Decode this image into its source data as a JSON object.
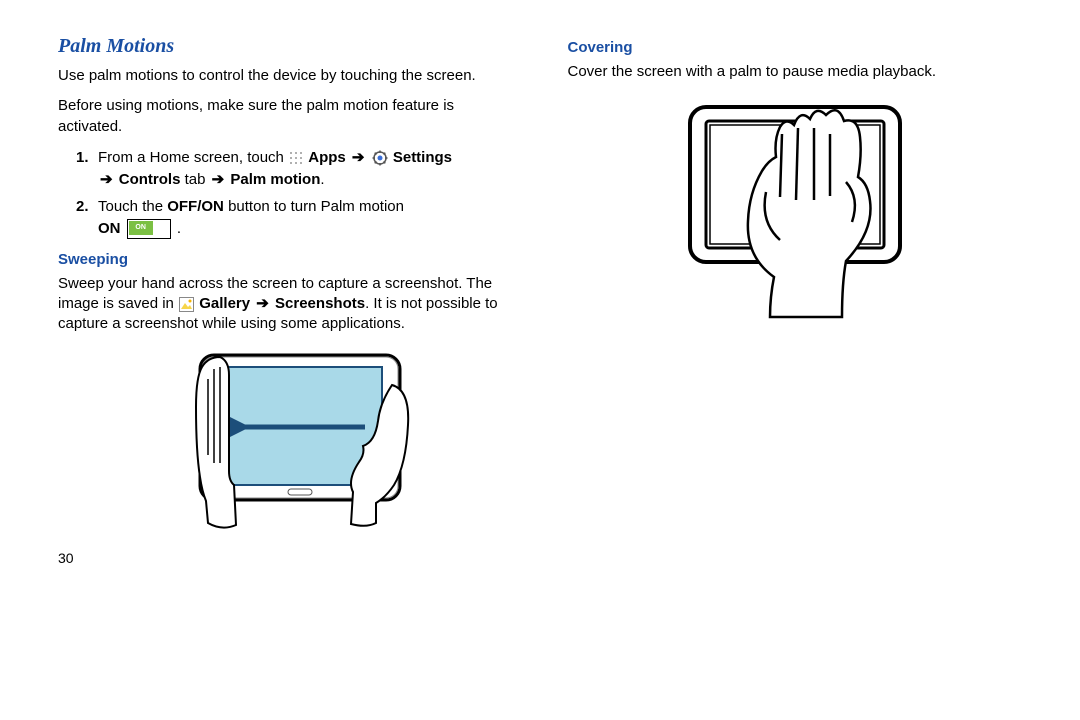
{
  "pageNumber": "30",
  "left": {
    "title": "Palm Motions",
    "para1": "Use palm motions to control the device by touching the screen.",
    "para2": "Before using motions, make sure the palm motion feature is activated.",
    "step1_num": "1.",
    "step1_a": "From a Home screen, touch ",
    "step1_apps": "Apps",
    "step1_settings": "Settings",
    "step1_controls": "Controls",
    "step1_tab": " tab ",
    "step1_palm": "Palm motion",
    "step1_dot": ".",
    "step2_num": "2.",
    "step2_a": "Touch the ",
    "step2_offon": "OFF/ON",
    "step2_b": " button to turn Palm motion ",
    "step2_on": "ON",
    "step2_onLabel": "ON",
    "step2_dot": " .",
    "sweeping": "Sweeping",
    "sweep_a": "Sweep your hand across the screen to capture a screenshot. The image is saved in ",
    "sweep_gallery": "Gallery",
    "sweep_screenshots": "Screenshots",
    "sweep_b": ". It is not possible to capture a screenshot while using some applications."
  },
  "right": {
    "covering": "Covering",
    "cover_para": "Cover the screen with a palm to pause media playback."
  }
}
